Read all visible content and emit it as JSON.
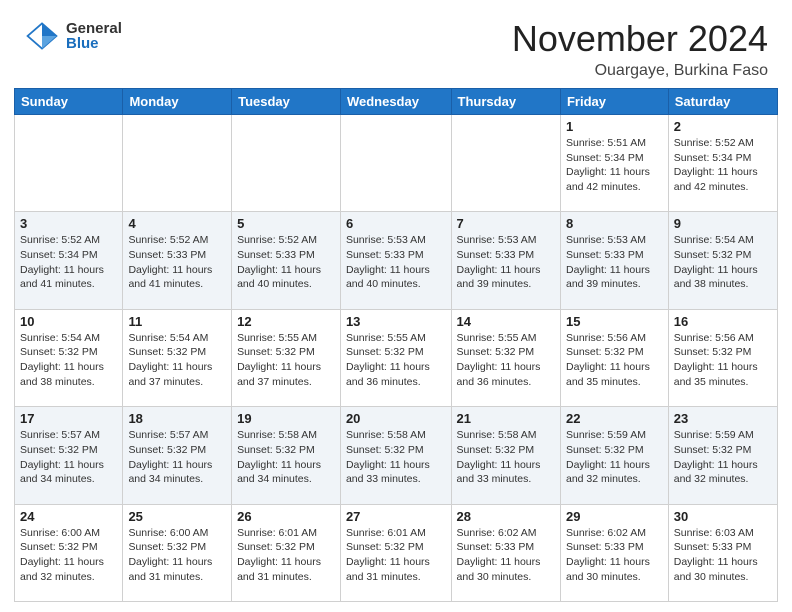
{
  "header": {
    "logo_general": "General",
    "logo_blue": "Blue",
    "title": "November 2024",
    "subtitle": "Ouargaye, Burkina Faso"
  },
  "days_of_week": [
    "Sunday",
    "Monday",
    "Tuesday",
    "Wednesday",
    "Thursday",
    "Friday",
    "Saturday"
  ],
  "weeks": [
    [
      {
        "day": "",
        "info": ""
      },
      {
        "day": "",
        "info": ""
      },
      {
        "day": "",
        "info": ""
      },
      {
        "day": "",
        "info": ""
      },
      {
        "day": "",
        "info": ""
      },
      {
        "day": "1",
        "info": "Sunrise: 5:51 AM\nSunset: 5:34 PM\nDaylight: 11 hours and 42 minutes."
      },
      {
        "day": "2",
        "info": "Sunrise: 5:52 AM\nSunset: 5:34 PM\nDaylight: 11 hours and 42 minutes."
      }
    ],
    [
      {
        "day": "3",
        "info": "Sunrise: 5:52 AM\nSunset: 5:34 PM\nDaylight: 11 hours and 41 minutes."
      },
      {
        "day": "4",
        "info": "Sunrise: 5:52 AM\nSunset: 5:33 PM\nDaylight: 11 hours and 41 minutes."
      },
      {
        "day": "5",
        "info": "Sunrise: 5:52 AM\nSunset: 5:33 PM\nDaylight: 11 hours and 40 minutes."
      },
      {
        "day": "6",
        "info": "Sunrise: 5:53 AM\nSunset: 5:33 PM\nDaylight: 11 hours and 40 minutes."
      },
      {
        "day": "7",
        "info": "Sunrise: 5:53 AM\nSunset: 5:33 PM\nDaylight: 11 hours and 39 minutes."
      },
      {
        "day": "8",
        "info": "Sunrise: 5:53 AM\nSunset: 5:33 PM\nDaylight: 11 hours and 39 minutes."
      },
      {
        "day": "9",
        "info": "Sunrise: 5:54 AM\nSunset: 5:32 PM\nDaylight: 11 hours and 38 minutes."
      }
    ],
    [
      {
        "day": "10",
        "info": "Sunrise: 5:54 AM\nSunset: 5:32 PM\nDaylight: 11 hours and 38 minutes."
      },
      {
        "day": "11",
        "info": "Sunrise: 5:54 AM\nSunset: 5:32 PM\nDaylight: 11 hours and 37 minutes."
      },
      {
        "day": "12",
        "info": "Sunrise: 5:55 AM\nSunset: 5:32 PM\nDaylight: 11 hours and 37 minutes."
      },
      {
        "day": "13",
        "info": "Sunrise: 5:55 AM\nSunset: 5:32 PM\nDaylight: 11 hours and 36 minutes."
      },
      {
        "day": "14",
        "info": "Sunrise: 5:55 AM\nSunset: 5:32 PM\nDaylight: 11 hours and 36 minutes."
      },
      {
        "day": "15",
        "info": "Sunrise: 5:56 AM\nSunset: 5:32 PM\nDaylight: 11 hours and 35 minutes."
      },
      {
        "day": "16",
        "info": "Sunrise: 5:56 AM\nSunset: 5:32 PM\nDaylight: 11 hours and 35 minutes."
      }
    ],
    [
      {
        "day": "17",
        "info": "Sunrise: 5:57 AM\nSunset: 5:32 PM\nDaylight: 11 hours and 34 minutes."
      },
      {
        "day": "18",
        "info": "Sunrise: 5:57 AM\nSunset: 5:32 PM\nDaylight: 11 hours and 34 minutes."
      },
      {
        "day": "19",
        "info": "Sunrise: 5:58 AM\nSunset: 5:32 PM\nDaylight: 11 hours and 34 minutes."
      },
      {
        "day": "20",
        "info": "Sunrise: 5:58 AM\nSunset: 5:32 PM\nDaylight: 11 hours and 33 minutes."
      },
      {
        "day": "21",
        "info": "Sunrise: 5:58 AM\nSunset: 5:32 PM\nDaylight: 11 hours and 33 minutes."
      },
      {
        "day": "22",
        "info": "Sunrise: 5:59 AM\nSunset: 5:32 PM\nDaylight: 11 hours and 32 minutes."
      },
      {
        "day": "23",
        "info": "Sunrise: 5:59 AM\nSunset: 5:32 PM\nDaylight: 11 hours and 32 minutes."
      }
    ],
    [
      {
        "day": "24",
        "info": "Sunrise: 6:00 AM\nSunset: 5:32 PM\nDaylight: 11 hours and 32 minutes."
      },
      {
        "day": "25",
        "info": "Sunrise: 6:00 AM\nSunset: 5:32 PM\nDaylight: 11 hours and 31 minutes."
      },
      {
        "day": "26",
        "info": "Sunrise: 6:01 AM\nSunset: 5:32 PM\nDaylight: 11 hours and 31 minutes."
      },
      {
        "day": "27",
        "info": "Sunrise: 6:01 AM\nSunset: 5:32 PM\nDaylight: 11 hours and 31 minutes."
      },
      {
        "day": "28",
        "info": "Sunrise: 6:02 AM\nSunset: 5:33 PM\nDaylight: 11 hours and 30 minutes."
      },
      {
        "day": "29",
        "info": "Sunrise: 6:02 AM\nSunset: 5:33 PM\nDaylight: 11 hours and 30 minutes."
      },
      {
        "day": "30",
        "info": "Sunrise: 6:03 AM\nSunset: 5:33 PM\nDaylight: 11 hours and 30 minutes."
      }
    ]
  ]
}
